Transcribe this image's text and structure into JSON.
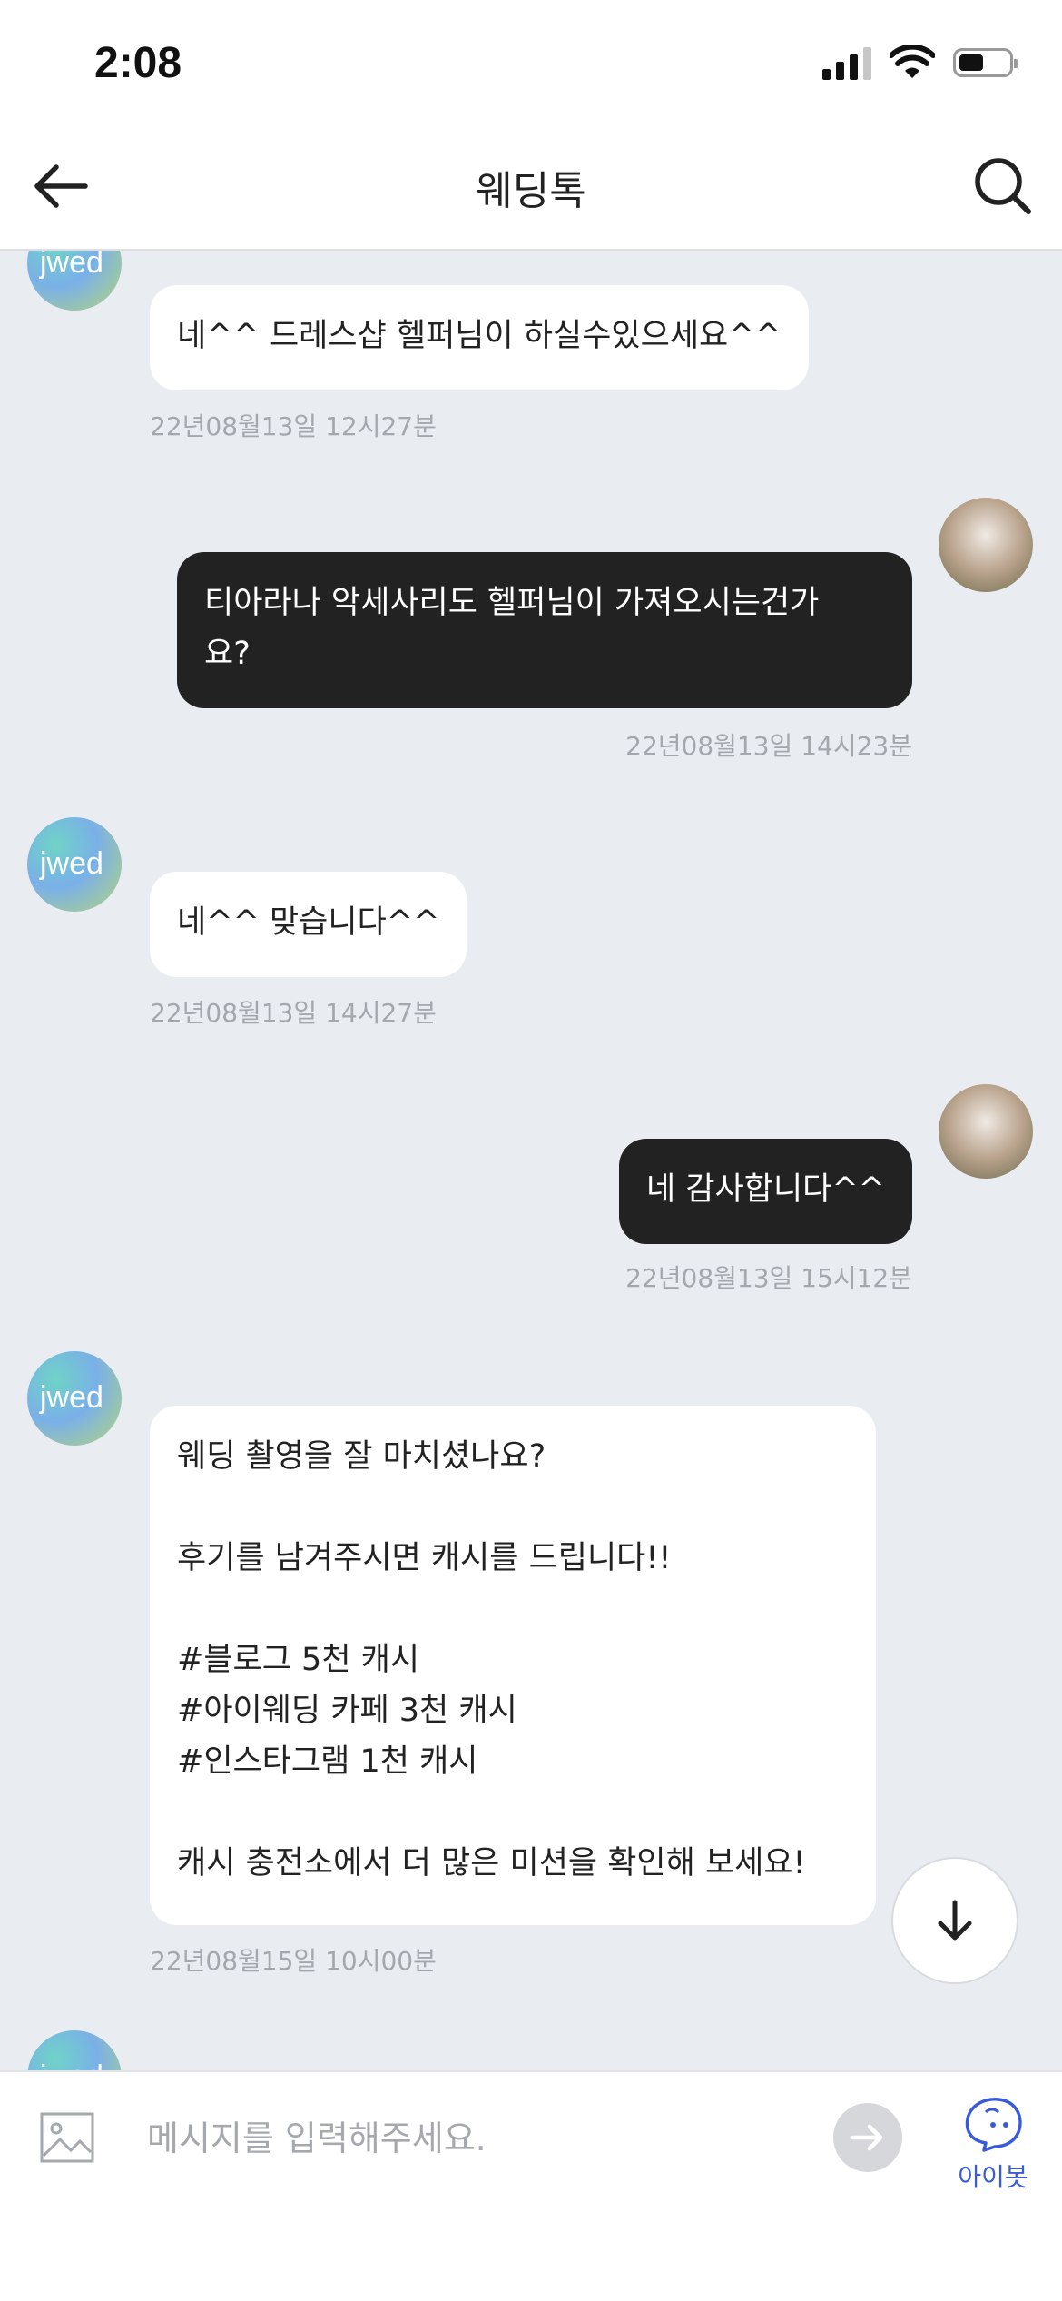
{
  "status_bar": {
    "time": "2:08"
  },
  "header": {
    "title": "웨딩톡"
  },
  "messages": [
    {
      "side": "in",
      "text": "네^^ 드레스샵 헬퍼님이 하실수있으세요^^",
      "time": "22년08월13일 12시27분"
    },
    {
      "side": "out",
      "text": "티아라나 악세사리도 헬퍼님이 가져오시는건가\n요?",
      "time": "22년08월13일 14시23분"
    },
    {
      "side": "in",
      "text": "네^^ 맞습니다^^",
      "time": "22년08월13일 14시27분"
    },
    {
      "side": "out",
      "text": "네 감사합니다^^",
      "time": "22년08월13일 15시12분"
    },
    {
      "side": "in",
      "text": "웨딩 촬영을 잘 마치셨나요?\n\n후기를 남겨주시면 캐시를 드립니다!!\n\n#블로그 5천 캐시\n#아이웨딩 카페 3천 캐시\n#인스타그램 1천 캐시\n\n캐시 충전소에서 더 많은 미션을 확인해 보세요!",
      "time": "22년08월15일 10시00분"
    }
  ],
  "input": {
    "placeholder": "메시지를 입력해주세요."
  },
  "bot_button": {
    "label": "아이봇"
  },
  "icons": {
    "back": "arrow-left-icon",
    "search": "search-icon",
    "scroll_down": "arrow-down-icon",
    "image": "image-icon",
    "send": "arrow-right-icon",
    "bot": "chatbot-face-icon"
  },
  "colors": {
    "background": "#e9edf2",
    "outgoing_bubble": "#222222",
    "incoming_bubble": "#ffffff",
    "bot_accent": "#3a5bd9"
  }
}
